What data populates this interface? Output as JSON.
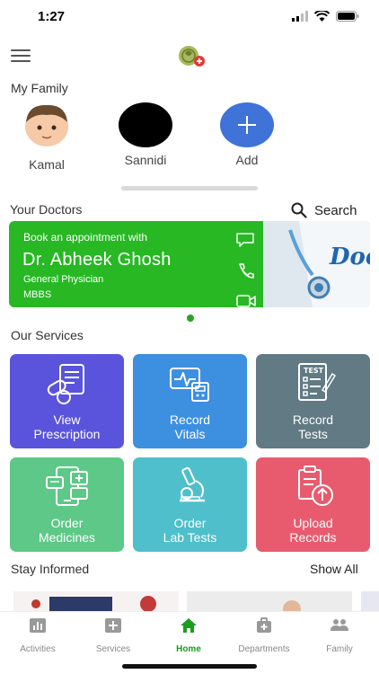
{
  "status_bar": {
    "time": "1:27"
  },
  "topbar": {
    "menu_icon": "hamburger-icon",
    "logo_icon": "app-logo-icon"
  },
  "family": {
    "title": "My Family",
    "members": [
      {
        "name": "Kamal",
        "avatar": "boy-emoji-avatar"
      },
      {
        "name": "Sannidi",
        "avatar": "black-avatar"
      },
      {
        "name": "Add",
        "avatar": "plus-icon"
      }
    ]
  },
  "doctors": {
    "title": "Your Doctors",
    "search_label": "Search",
    "card": {
      "subtitle": "Book an appointment with",
      "name": "Dr. Abheek Ghosh",
      "role": "General Physician",
      "degree": "MBBS",
      "banner_text": "Doc"
    }
  },
  "services": {
    "title": "Our Services",
    "tiles": [
      {
        "label": "View\nPrescription",
        "color": "#5a54dc",
        "icon": "prescription-icon"
      },
      {
        "label": "Record\nVitals",
        "color": "#3d8fe0",
        "icon": "vitals-icon"
      },
      {
        "label": "Record\nTests",
        "color": "#617a84",
        "icon": "test-report-icon"
      },
      {
        "label": "Order\nMedicines",
        "color": "#5dc887",
        "icon": "medicine-order-icon"
      },
      {
        "label": "Order\nLab Tests",
        "color": "#4fbfcb",
        "icon": "microscope-icon"
      },
      {
        "label": "Upload\nRecords",
        "color": "#e85b6e",
        "icon": "upload-records-icon"
      }
    ]
  },
  "stay_informed": {
    "title": "Stay Informed",
    "show_all": "Show All"
  },
  "tabbar": {
    "tabs": [
      {
        "label": "Activities",
        "icon": "activities-icon"
      },
      {
        "label": "Services",
        "icon": "services-icon"
      },
      {
        "label": "Home",
        "icon": "home-icon",
        "active": true
      },
      {
        "label": "Departments",
        "icon": "departments-icon"
      },
      {
        "label": "Family",
        "icon": "family-icon"
      }
    ]
  },
  "colors": {
    "accent_green": "#27b824",
    "active_tab": "#1e9c1e",
    "add_button": "#3f73d8"
  }
}
